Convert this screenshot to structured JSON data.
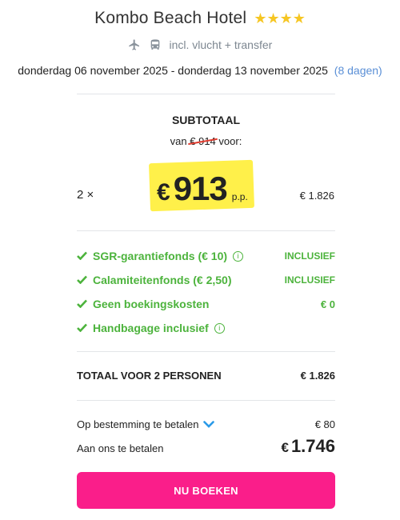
{
  "hotel": {
    "name": "Kombo Beach Hotel",
    "stars": "★★★★",
    "transport_text": "incl. vlucht + transfer",
    "transport_icons": [
      "plane-icon",
      "bus-icon"
    ],
    "dates": "donderdag 06 november 2025 - donderdag 13 november 2025",
    "duration": "(8 dagen)"
  },
  "pricing": {
    "subtotal_label": "SUBTOTAAL",
    "from_prefix": "van",
    "old_price": "€ 914",
    "from_suffix": "voor:",
    "quantity": "2 ×",
    "currency": "€",
    "price_per_person": "913",
    "per_person_label": "p.p.",
    "line_total": "€ 1.826"
  },
  "inclusions": [
    {
      "label": "SGR-garantiefonds  (€ 10)",
      "has_info": true,
      "value": "INCLUSIEF"
    },
    {
      "label": "Calamiteitenfonds  (€ 2,50)",
      "has_info": false,
      "value": "INCLUSIEF"
    },
    {
      "label": "Geen boekingskosten",
      "has_info": false,
      "value": "€ 0"
    },
    {
      "label": "Handbagage inclusief",
      "has_info": true,
      "value": ""
    }
  ],
  "totals": {
    "total_label": "TOTAAL VOOR 2 PERSONEN",
    "total_value": "€ 1.826",
    "destination_label": "Op bestemming te betalen",
    "destination_value": "€ 80",
    "pay_label": "Aan ons te betalen",
    "pay_currency": "€",
    "pay_amount": "1.746"
  },
  "cta": {
    "book_label": "NU BOEKEN"
  },
  "colors": {
    "accent_pink": "#fa1e8a",
    "success_green": "#4cb33c",
    "highlight_yellow": "#fff04a",
    "star_yellow": "#f6c623",
    "link_blue": "#5a8fd6"
  }
}
